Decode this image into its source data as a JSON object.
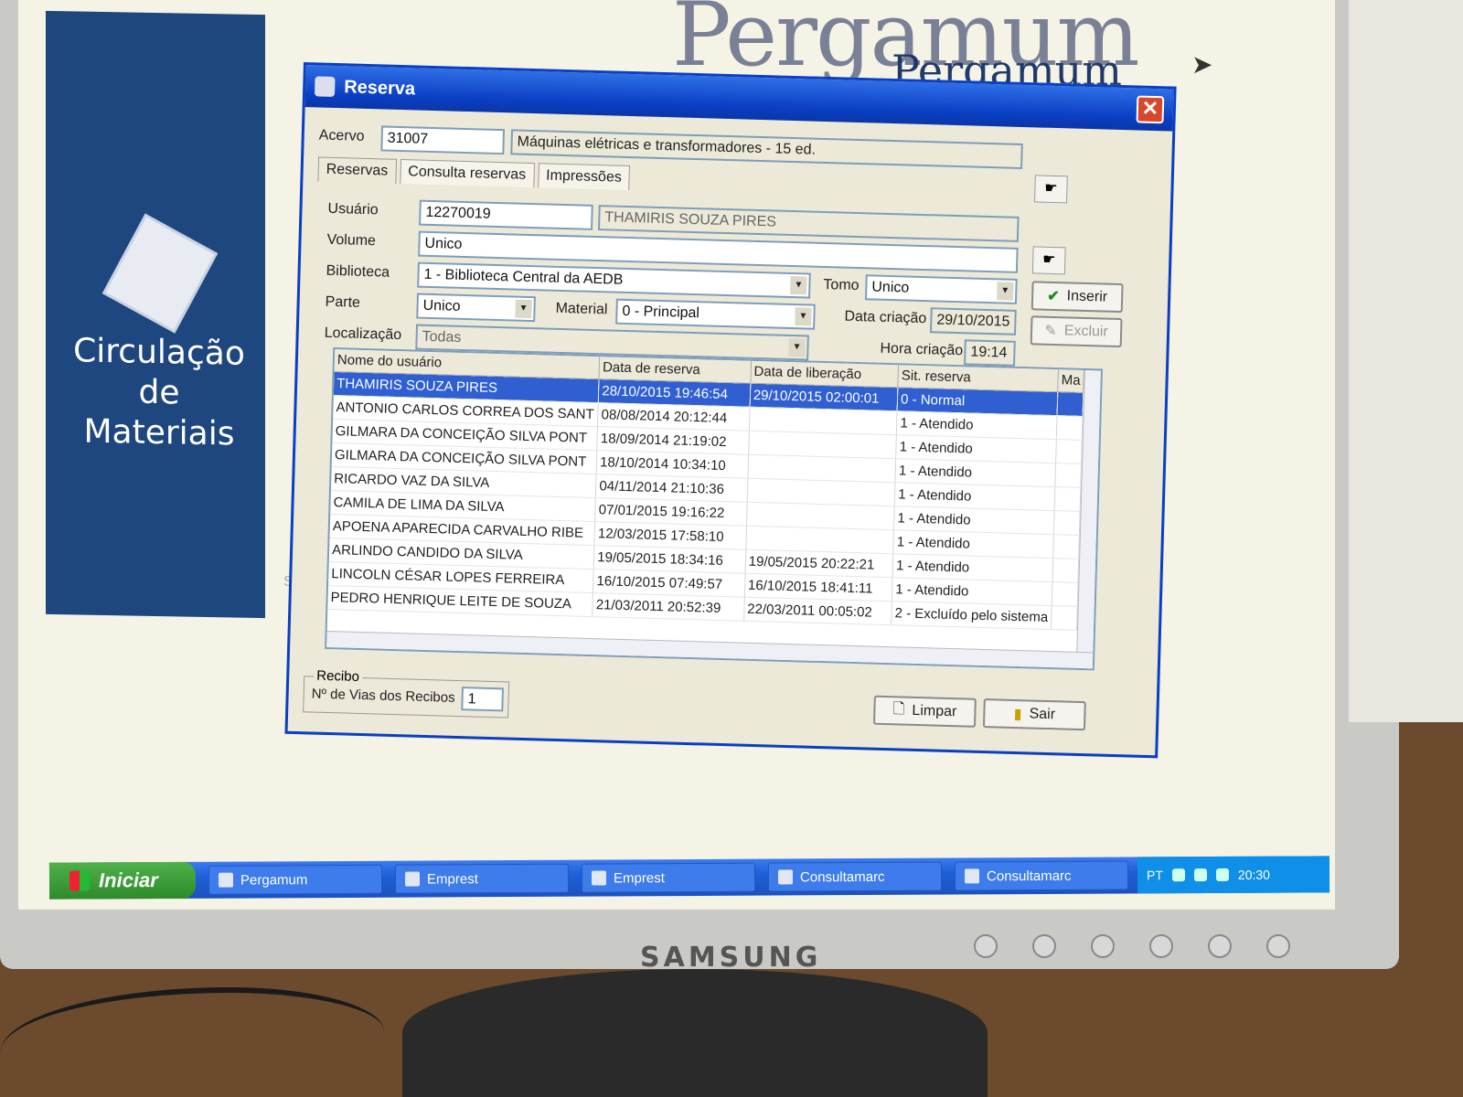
{
  "monitor": {
    "brand": "SAMSUNG"
  },
  "desktop": {
    "logo_text": "Pergamum",
    "logo_text_small": "Pergamum",
    "side_title_line1": "Circulação",
    "side_title_line2": "de Materiais",
    "stray_text": "Si"
  },
  "dialog": {
    "title": "Reserva",
    "acervo_label": "Acervo",
    "acervo_code": "31007",
    "acervo_title": "Máquinas elétricas e transformadores - 15 ed.",
    "tabs": [
      {
        "label": "Reservas"
      },
      {
        "label": "Consulta reservas"
      },
      {
        "label": "Impressões"
      }
    ],
    "usuario_label": "Usuário",
    "usuario_code": "12270019",
    "usuario_name": "THAMIRIS SOUZA PIRES",
    "volume_label": "Volume",
    "volume_value": "Unico",
    "tomo_label": "Tomo",
    "tomo_value": "Unico",
    "biblioteca_label": "Biblioteca",
    "biblioteca_value": "1 - Biblioteca Central da AEDB",
    "parte_label": "Parte",
    "parte_value": "Unico",
    "material_label": "Material",
    "material_value": "0 - Principal",
    "localizacao_label": "Localização",
    "localizacao_value": "Todas",
    "data_criacao_label": "Data criação",
    "data_criacao_value": "29/10/2015",
    "hora_criacao_label": "Hora criação",
    "hora_criacao_value": "19:14",
    "inserir_label": "Inserir",
    "excluir_label": "Excluir",
    "recibo_caption": "Recibo",
    "vias_label": "Nº de Vias dos Recibos",
    "vias_value": "1",
    "limpar_label": "Limpar",
    "sair_label": "Sair",
    "grid": {
      "columns": [
        "Nome do usuário",
        "Data de reserva",
        "Data de liberação",
        "Sit. reserva",
        "Ma"
      ],
      "rows": [
        [
          "THAMIRIS SOUZA PIRES",
          "28/10/2015 19:46:54",
          "29/10/2015 02:00:01",
          "0 - Normal",
          ""
        ],
        [
          "ANTONIO CARLOS CORREA DOS SANT",
          "08/08/2014 20:12:44",
          "",
          "1 - Atendido",
          ""
        ],
        [
          "GILMARA DA CONCEIÇÃO SILVA PONT",
          "18/09/2014 21:19:02",
          "",
          "1 - Atendido",
          ""
        ],
        [
          "GILMARA DA CONCEIÇÃO SILVA PONT",
          "18/10/2014 10:34:10",
          "",
          "1 - Atendido",
          ""
        ],
        [
          "RICARDO VAZ DA SILVA",
          "04/11/2014 21:10:36",
          "",
          "1 - Atendido",
          ""
        ],
        [
          "CAMILA DE LIMA DA SILVA",
          "07/01/2015 19:16:22",
          "",
          "1 - Atendido",
          ""
        ],
        [
          "APOENA APARECIDA CARVALHO RIBE",
          "12/03/2015 17:58:10",
          "",
          "1 - Atendido",
          ""
        ],
        [
          "ARLINDO CANDIDO DA SILVA",
          "19/05/2015 18:34:16",
          "19/05/2015 20:22:21",
          "1 - Atendido",
          ""
        ],
        [
          "LINCOLN CÉSAR LOPES FERREIRA",
          "16/10/2015 07:49:57",
          "16/10/2015 18:41:11",
          "1 - Atendido",
          ""
        ],
        [
          "PEDRO HENRIQUE LEITE DE SOUZA",
          "21/03/2011 20:52:39",
          "22/03/2011 00:05:02",
          "2 - Excluído pelo sistema",
          ""
        ]
      ]
    }
  },
  "taskbar": {
    "start_label": "Iniciar",
    "items": [
      {
        "label": "Pergamum"
      },
      {
        "label": "Emprest"
      },
      {
        "label": "Emprest"
      },
      {
        "label": "Consultamarc"
      },
      {
        "label": "Consultamarc"
      }
    ],
    "language": "PT",
    "clock": "20:30"
  },
  "colors": {
    "titlebar": "#0a3fc4",
    "selection": "#2f5fd0",
    "sidepanel": "#1e4780"
  }
}
